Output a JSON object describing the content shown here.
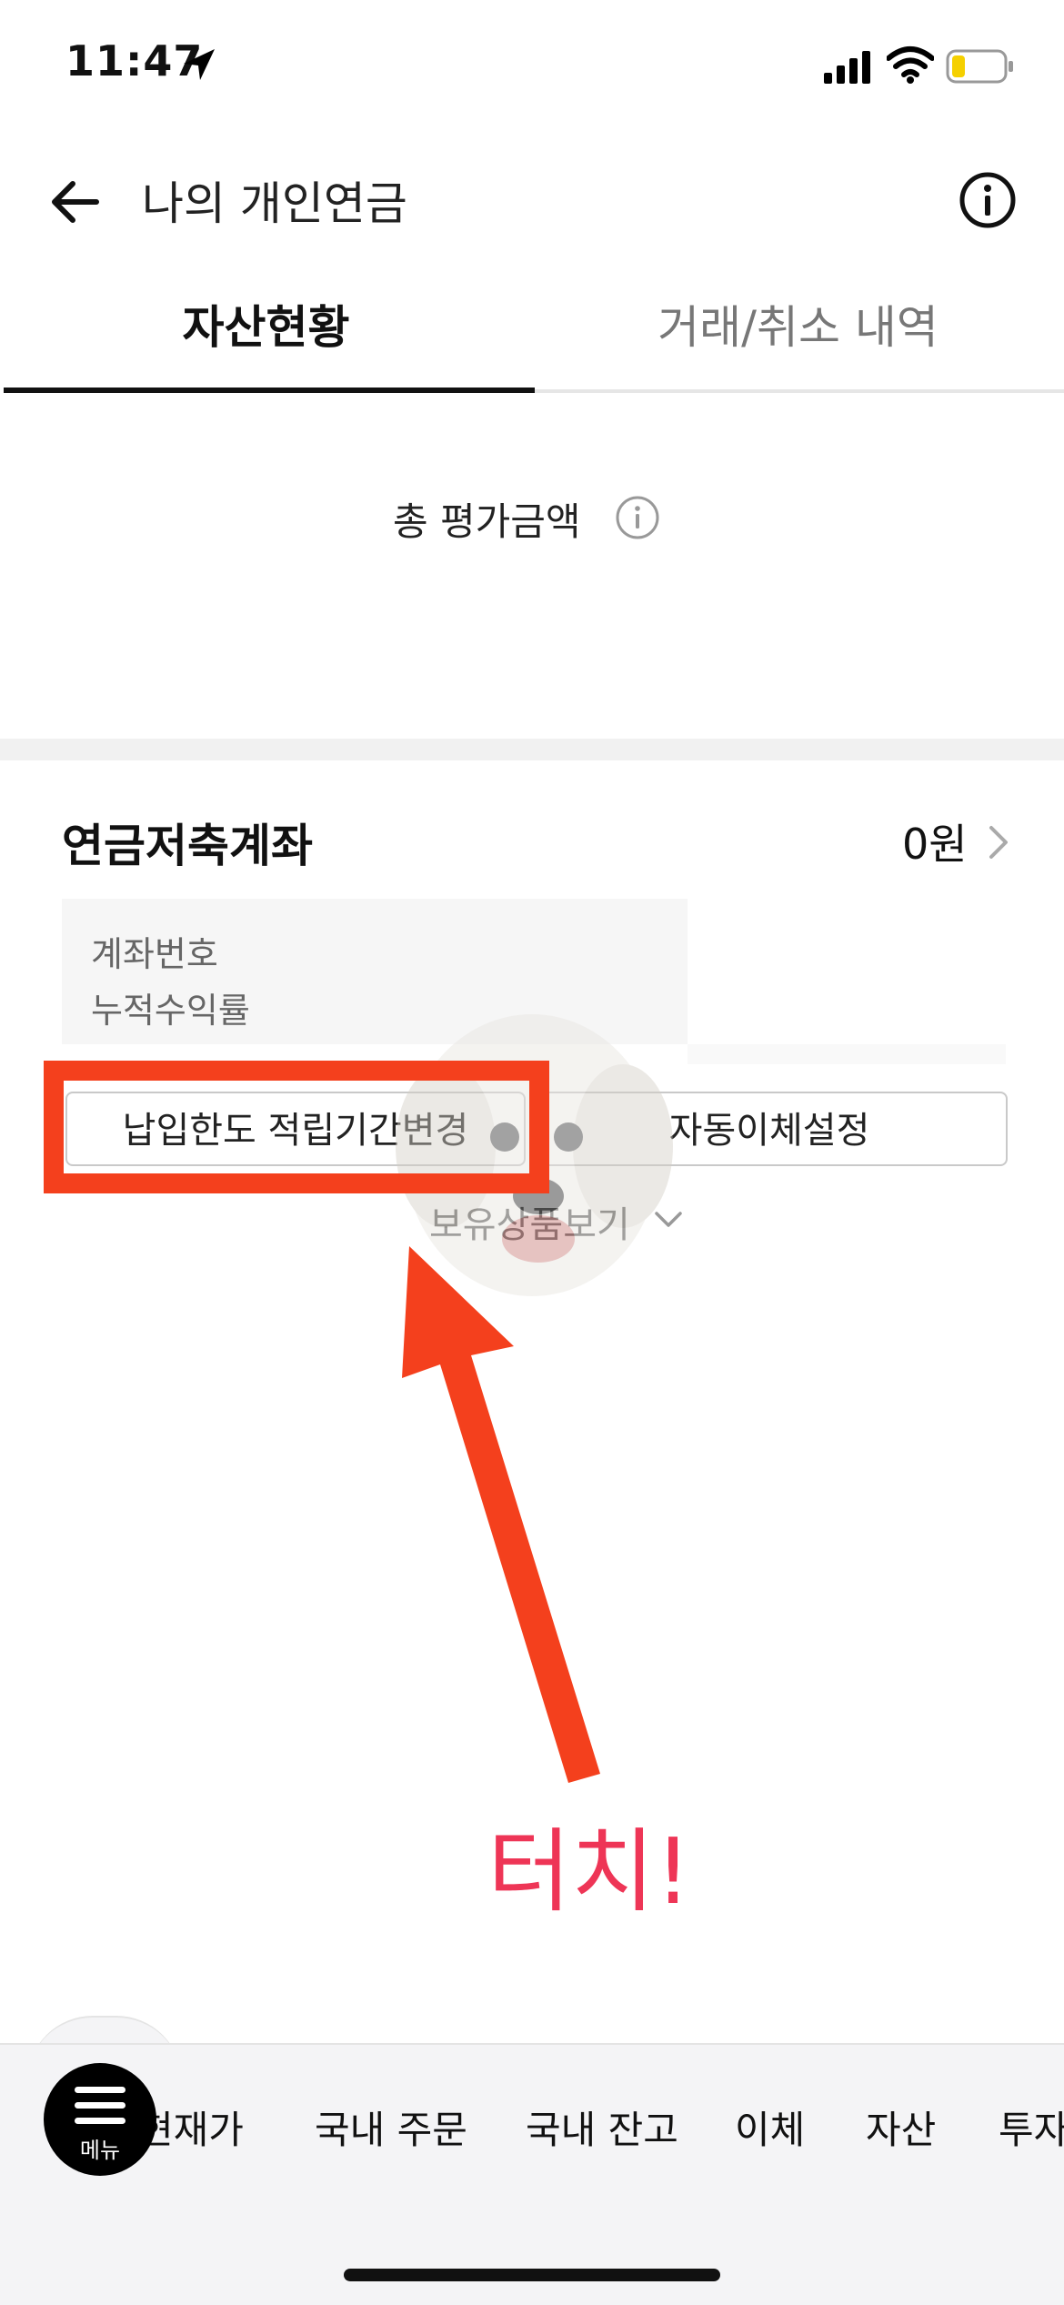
{
  "status_bar": {
    "time": "11:47"
  },
  "header": {
    "title": "나의 개인연금"
  },
  "tabs": [
    {
      "label": "자산현황",
      "active": true
    },
    {
      "label": "거래/취소 내역",
      "active": false
    }
  ],
  "summary": {
    "total_label": "총 평가금액"
  },
  "account": {
    "title": "연금저축계좌",
    "amount": "0원",
    "info_rows": [
      "계좌번호",
      "누적수익률"
    ],
    "buttons": {
      "limit_change": "납입한도 적립기간변경",
      "auto_transfer": "자동이체설정"
    },
    "holdings_toggle": "보유상품보기"
  },
  "annotation": {
    "caption": "터치!",
    "color": "#f4401d",
    "caption_color": "#ee3556"
  },
  "bottom_nav": {
    "menu_label": "메뉴",
    "items": [
      "현재가",
      "국내 주문",
      "국내 잔고",
      "이체",
      "자산",
      "투자"
    ]
  }
}
